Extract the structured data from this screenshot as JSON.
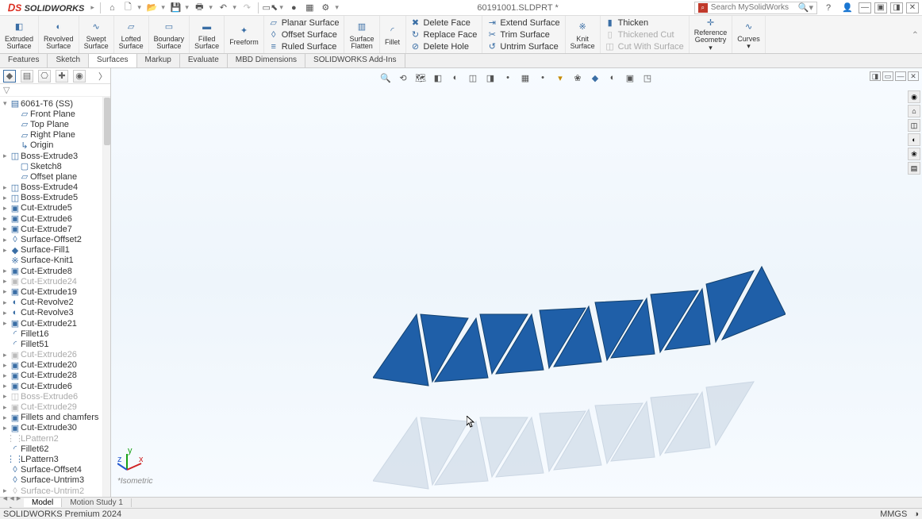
{
  "app": {
    "name": "SOLIDWORKS",
    "document_title": "60191001.SLDPRT *"
  },
  "search": {
    "placeholder": "Search MySolidWorks"
  },
  "ribbon": {
    "big": [
      {
        "label": "Extruded\nSurface",
        "icon": "◧"
      },
      {
        "label": "Revolved\nSurface",
        "icon": "◐"
      },
      {
        "label": "Swept\nSurface",
        "icon": "∿"
      },
      {
        "label": "Lofted\nSurface",
        "icon": "▱"
      },
      {
        "label": "Boundary\nSurface",
        "icon": "▭"
      },
      {
        "label": "Filled\nSurface",
        "icon": "▬"
      },
      {
        "label": "Freeform",
        "icon": "✦"
      }
    ],
    "surface_col": {
      "planar": "Planar Surface",
      "offset": "Offset Surface",
      "ruled": "Ruled Surface"
    },
    "flatten": {
      "label": "Surface\nFlatten"
    },
    "fillet": {
      "label": "Fillet"
    },
    "face_col": {
      "delete_face": "Delete Face",
      "replace_face": "Replace Face",
      "delete_hole": "Delete Hole"
    },
    "trim_col": {
      "extend": "Extend Surface",
      "trim": "Trim Surface",
      "untrim": "Untrim Surface"
    },
    "knit": {
      "label": "Knit\nSurface"
    },
    "thicken_col": {
      "thicken": "Thicken",
      "thickened_cut": "Thickened Cut",
      "cut_with_surface": "Cut With Surface"
    },
    "ref": {
      "label": "Reference\nGeometry"
    },
    "curves": {
      "label": "Curves"
    }
  },
  "tabs": [
    "Features",
    "Sketch",
    "Surfaces",
    "Markup",
    "Evaluate",
    "MBD Dimensions",
    "SOLIDWORKS Add-Ins"
  ],
  "active_tab": 2,
  "tree": [
    {
      "label": "6061-T6 (SS)",
      "icon": "▤",
      "exp": false,
      "indent": 0
    },
    {
      "label": "Front Plane",
      "icon": "▱",
      "indent": 1
    },
    {
      "label": "Top Plane",
      "icon": "▱",
      "indent": 1
    },
    {
      "label": "Right Plane",
      "icon": "▱",
      "indent": 1
    },
    {
      "label": "Origin",
      "icon": "↳",
      "indent": 1
    },
    {
      "label": "Boss-Extrude3",
      "icon": "◫",
      "exp": true,
      "indent": 0
    },
    {
      "label": "Sketch8",
      "icon": "▢",
      "indent": 1
    },
    {
      "label": "Offset plane",
      "icon": "▱",
      "indent": 1
    },
    {
      "label": "Boss-Extrude4",
      "icon": "◫",
      "exp": true,
      "indent": 0
    },
    {
      "label": "Boss-Extrude5",
      "icon": "◫",
      "exp": true,
      "indent": 0
    },
    {
      "label": "Cut-Extrude5",
      "icon": "▣",
      "exp": true,
      "indent": 0
    },
    {
      "label": "Cut-Extrude6",
      "icon": "▣",
      "exp": true,
      "indent": 0
    },
    {
      "label": "Cut-Extrude7",
      "icon": "▣",
      "exp": true,
      "indent": 0
    },
    {
      "label": "Surface-Offset2",
      "icon": "◊",
      "exp": true,
      "indent": 0
    },
    {
      "label": "Surface-Fill1",
      "icon": "◆",
      "exp": true,
      "indent": 0
    },
    {
      "label": "Surface-Knit1",
      "icon": "※",
      "indent": 0
    },
    {
      "label": "Cut-Extrude8",
      "icon": "▣",
      "exp": true,
      "indent": 0
    },
    {
      "label": "Cut-Extrude24",
      "icon": "▣",
      "exp": true,
      "indent": 0,
      "suppressed": true
    },
    {
      "label": "Cut-Extrude19",
      "icon": "▣",
      "exp": true,
      "indent": 0
    },
    {
      "label": "Cut-Revolve2",
      "icon": "◐",
      "exp": true,
      "indent": 0
    },
    {
      "label": "Cut-Revolve3",
      "icon": "◐",
      "exp": true,
      "indent": 0
    },
    {
      "label": "Cut-Extrude21",
      "icon": "▣",
      "exp": true,
      "indent": 0
    },
    {
      "label": "Fillet16",
      "icon": "◜",
      "indent": 0
    },
    {
      "label": "Fillet51",
      "icon": "◜",
      "indent": 0
    },
    {
      "label": "Cut-Extrude26",
      "icon": "▣",
      "exp": true,
      "indent": 0,
      "suppressed": true
    },
    {
      "label": "Cut-Extrude20",
      "icon": "▣",
      "exp": true,
      "indent": 0
    },
    {
      "label": "Cut-Extrude28",
      "icon": "▣",
      "exp": true,
      "indent": 0
    },
    {
      "label": "Cut-Extrude6",
      "icon": "▣",
      "exp": true,
      "indent": 0
    },
    {
      "label": "Boss-Extrude6",
      "icon": "◫",
      "exp": true,
      "indent": 0,
      "suppressed": true
    },
    {
      "label": "Cut-Extrude29",
      "icon": "▣",
      "exp": true,
      "indent": 0,
      "suppressed": true
    },
    {
      "label": "Fillets and chamfers",
      "icon": "▣",
      "exp": true,
      "indent": 0
    },
    {
      "label": "Cut-Extrude30",
      "icon": "▣",
      "exp": true,
      "indent": 0
    },
    {
      "label": "LPattern2",
      "icon": "⋮⋮",
      "indent": 0,
      "suppressed": true
    },
    {
      "label": "Fillet62",
      "icon": "◜",
      "indent": 0
    },
    {
      "label": "LPattern3",
      "icon": "⋮⋮",
      "indent": 0
    },
    {
      "label": "Surface-Offset4",
      "icon": "◊",
      "indent": 0
    },
    {
      "label": "Surface-Untrim3",
      "icon": "◊",
      "indent": 0
    },
    {
      "label": "Surface-Untrim2",
      "icon": "◊",
      "exp": true,
      "indent": 0,
      "suppressed": true
    }
  ],
  "headsup_icons": [
    "🔍",
    "⟲",
    "🗺",
    "◧",
    "◐",
    "◫",
    "◨",
    "•",
    "▦",
    "•",
    "▾",
    "❀",
    "◆",
    "◐",
    "▣",
    "◳"
  ],
  "side_tools": [
    {
      "icon": "◉",
      "name": "appearance"
    },
    {
      "icon": "⌂",
      "name": "home-view"
    },
    {
      "icon": "◫",
      "name": "view-cube"
    },
    {
      "icon": "◐",
      "name": "display-style"
    },
    {
      "icon": "❀",
      "name": "scene"
    },
    {
      "icon": "▤",
      "name": "decals"
    }
  ],
  "view_label": "*Isometric",
  "bottom_tabs": {
    "model": "Model",
    "motion": "Motion Study 1"
  },
  "status": {
    "left": "SOLIDWORKS Premium 2024",
    "units": "MMGS"
  }
}
